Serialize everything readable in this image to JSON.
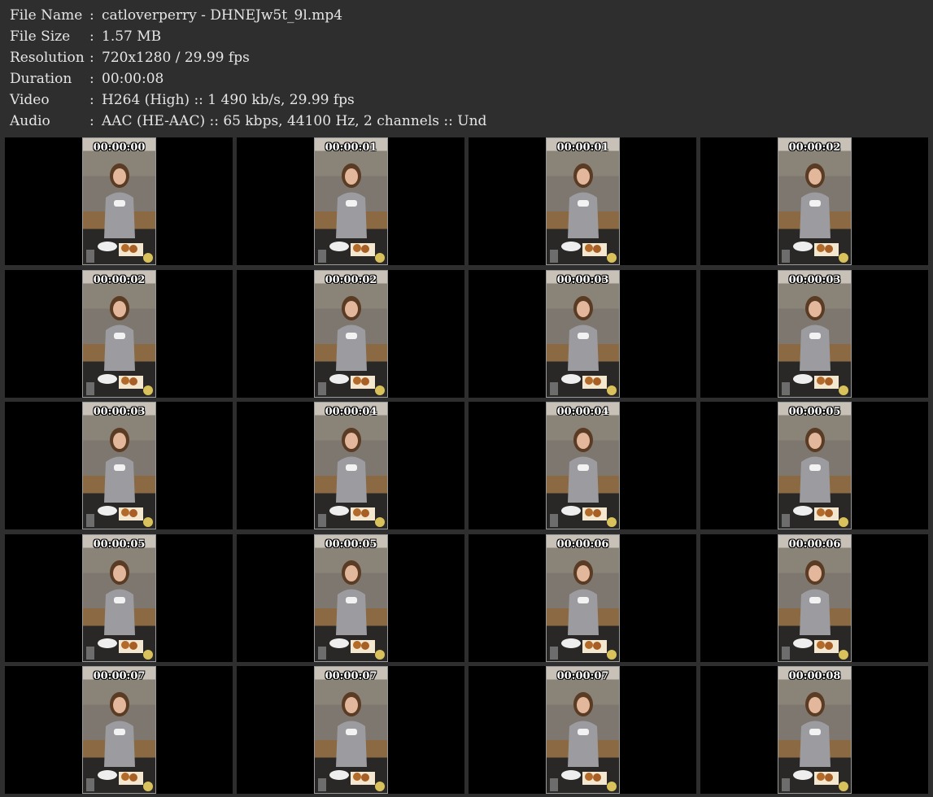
{
  "info": [
    {
      "label": "File Name",
      "value": "catloverperry - DHNEJw5t_9l.mp4"
    },
    {
      "label": "File Size",
      "value": "1.57 MB"
    },
    {
      "label": "Resolution",
      "value": "720x1280 / 29.99 fps"
    },
    {
      "label": "Duration",
      "value": "00:00:08"
    },
    {
      "label": "Video",
      "value": "H264 (High) :: 1 490 kb/s, 29.99 fps"
    },
    {
      "label": "Audio",
      "value": "AAC (HE-AAC) :: 65 kbps, 44100 Hz, 2 channels :: Und"
    }
  ],
  "separator": ":",
  "thumbnails": [
    "00:00:00",
    "00:00:01",
    "00:00:01",
    "00:00:02",
    "00:00:02",
    "00:00:02",
    "00:00:03",
    "00:00:03",
    "00:00:03",
    "00:00:04",
    "00:00:04",
    "00:00:05",
    "00:00:05",
    "00:00:05",
    "00:00:06",
    "00:00:06",
    "00:00:07",
    "00:00:07",
    "00:00:07",
    "00:00:08"
  ]
}
